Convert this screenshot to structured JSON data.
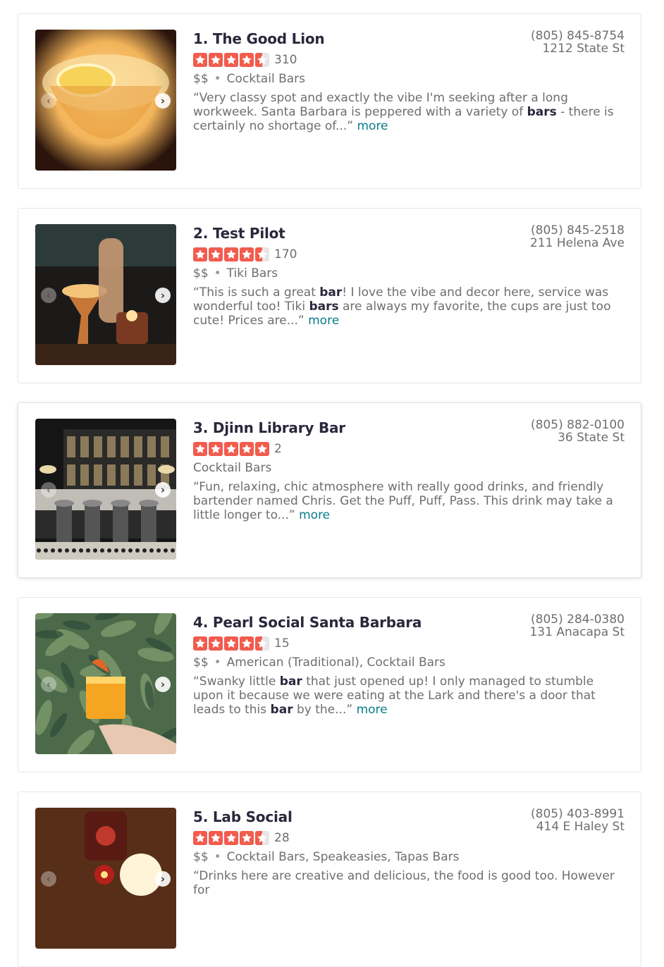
{
  "results": [
    {
      "title": "1. The Good Lion",
      "reviews": "310",
      "stars": [
        1,
        1,
        1,
        1,
        0.5
      ],
      "price": "$$",
      "categories": "Cocktail Bars",
      "snippet": [
        {
          "t": "“Very classy spot and exactly the vibe I'm seeking after a long workweek. Santa Barbara is peppered with a variety of "
        },
        {
          "t": "bars",
          "b": true
        },
        {
          "t": " - there is certainly no shortage of...” "
        }
      ],
      "more": "more",
      "phone": "(805) 845-8754",
      "address": "1212 State St",
      "photo_colors": [
        "#2a140c",
        "#f2b45a",
        "#ffd88a"
      ]
    },
    {
      "title": "2. Test Pilot",
      "reviews": "170",
      "stars": [
        1,
        1,
        1,
        1,
        0.5
      ],
      "price": "$$",
      "categories": "Tiki Bars",
      "snippet": [
        {
          "t": "“This is such a great "
        },
        {
          "t": "bar",
          "b": true
        },
        {
          "t": "! I love the vibe and decor here, service was wonderful too! Tiki "
        },
        {
          "t": "bars",
          "b": true
        },
        {
          "t": " are always my favorite, the cups are just too cute! Prices are...” "
        }
      ],
      "more": "more",
      "phone": "(805) 845-2518",
      "address": "211 Helena Ave",
      "photo_colors": [
        "#1c1a18",
        "#d9823c",
        "#f4c47a"
      ]
    },
    {
      "title": "3. Djinn Library Bar",
      "reviews": "2",
      "stars": [
        1,
        1,
        1,
        1,
        1
      ],
      "price": "",
      "categories": "Cocktail Bars",
      "snippet": [
        {
          "t": "“Fun, relaxing, chic atmosphere with really good drinks, and friendly bartender named Chris. Get the Puff, Puff, Pass. This drink may take a little longer to...” "
        }
      ],
      "more": "more",
      "phone": "(805) 882-0100",
      "address": "36 State St",
      "photo_colors": [
        "#151515",
        "#bfbdb6",
        "#6e6a5a"
      ]
    },
    {
      "title": "4. Pearl Social Santa Barbara",
      "reviews": "15",
      "stars": [
        1,
        1,
        1,
        1,
        0.5
      ],
      "price": "$$",
      "categories": "American (Traditional), Cocktail Bars",
      "snippet": [
        {
          "t": "“Swanky little "
        },
        {
          "t": "bar",
          "b": true
        },
        {
          "t": " that just opened up! I only managed to stumble upon it because we were eating at the Lark and there's a door that leads to this "
        },
        {
          "t": "bar",
          "b": true
        },
        {
          "t": " by the...” "
        }
      ],
      "more": "more",
      "phone": "(805) 284-0380",
      "address": "131 Anacapa St",
      "photo_colors": [
        "#4c6a4a",
        "#f6a523",
        "#e8c8b0"
      ]
    },
    {
      "title": "5. Lab Social",
      "reviews": "28",
      "stars": [
        1,
        1,
        1,
        1,
        0.5
      ],
      "price": "$$",
      "categories": "Cocktail Bars, Speakeasies, Tapas Bars",
      "snippet": [
        {
          "t": "“Drinks here are creative and delicious, the food is good too. However for"
        }
      ],
      "more": "",
      "phone": "(805) 403-8991",
      "address": "414 E Haley St",
      "photo_colors": [
        "#3a1c10",
        "#c0392b",
        "#f3d6a0"
      ]
    }
  ],
  "star_color": "#f15c4f",
  "link_color": "#0a7c8a"
}
